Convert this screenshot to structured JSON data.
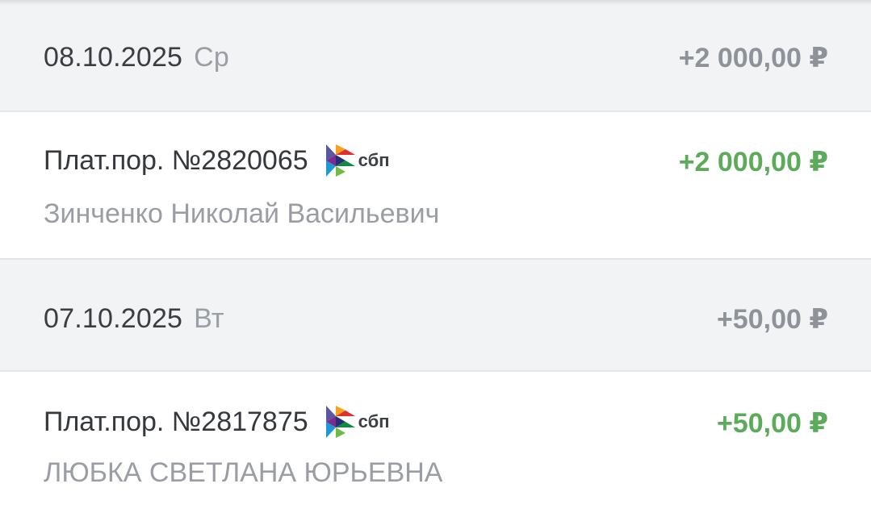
{
  "groups": [
    {
      "date": "08.10.2025",
      "weekday": "Ср",
      "total": "+2 000,00 ₽",
      "transaction": {
        "title": "Плат.пор. №2820065",
        "payment_system": "сбп",
        "payment_system_icon": "sbp-logo-icon",
        "amount": "+2 000,00 ₽",
        "counterparty": "Зинченко Николай Васильевич"
      }
    },
    {
      "date": "07.10.2025",
      "weekday": "Вт",
      "total": "+50,00 ₽",
      "transaction": {
        "title": "Плат.пор. №2817875",
        "payment_system": "сбп",
        "payment_system_icon": "sbp-logo-icon",
        "amount": "+50,00 ₽",
        "counterparty": "ЛЮБКА СВЕТЛАНА ЮРЬЕВНА"
      }
    }
  ],
  "colors": {
    "income_amount": "#5bab5b",
    "day_total": "#8e9299",
    "header_background": "#f2f3f5",
    "primary_text": "#35383d",
    "secondary_text": "#9a9da3"
  }
}
